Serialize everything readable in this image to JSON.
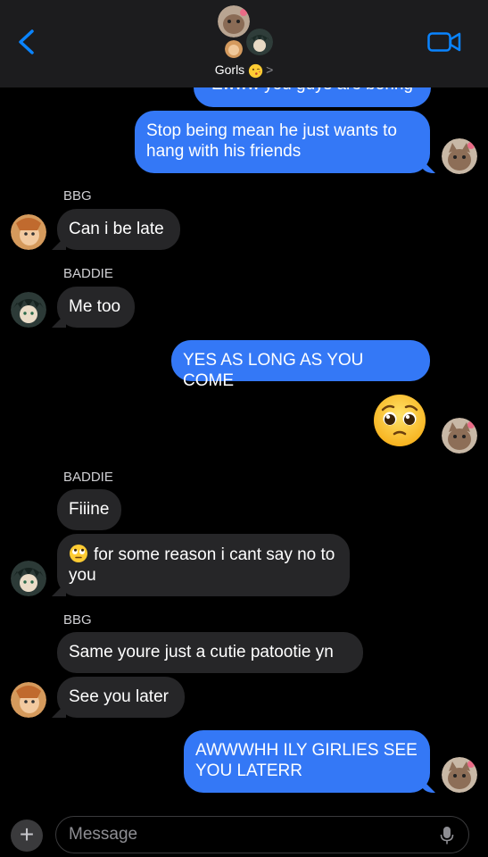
{
  "header": {
    "group_name": "Gorls",
    "chevron": ">"
  },
  "messages": [
    {
      "id": "m0",
      "text": "Ewww you guys are boring"
    },
    {
      "id": "m1",
      "text": "Stop being mean he just wants to hang with his friends"
    },
    {
      "id": "m2",
      "sender": "BBG",
      "text": "Can i be late"
    },
    {
      "id": "m3",
      "sender": "BADDIE",
      "text": "Me too"
    },
    {
      "id": "m4",
      "text": "YES AS LONG AS YOU COME"
    },
    {
      "id": "m5",
      "sender": "BADDIE",
      "text": "Fiiine"
    },
    {
      "id": "m6",
      "text": "for some reason i cant say no to you"
    },
    {
      "id": "m7",
      "sender": "BBG",
      "text": "Same youre just a cutie patootie yn"
    },
    {
      "id": "m8",
      "text": "See you later"
    },
    {
      "id": "m9",
      "text": "AWWWHH ILY GIRLIES SEE YOU LATERR"
    }
  ],
  "input": {
    "plus": "+",
    "placeholder": "Message"
  },
  "colors": {
    "outgoing_bubble": "#3478f6",
    "incoming_bubble": "#262628",
    "accent": "#0a84ff"
  },
  "icons": [
    "back-chevron-icon",
    "video-camera-icon",
    "plus-icon",
    "microphone-icon",
    "pleading-face-emoji",
    "eye-roll-emoji"
  ]
}
